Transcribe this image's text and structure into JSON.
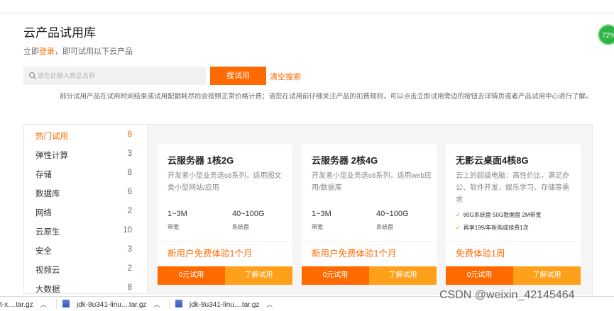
{
  "header": {
    "title": "云产品试用库",
    "subtitle_prefix": "立即",
    "subtitle_link": "登录",
    "subtitle_suffix": "，即可试用以下云产品",
    "badge": "72%"
  },
  "search": {
    "placeholder": "请在此输入商品名称",
    "button_label": "搜试用",
    "clear_label": "清空搜索"
  },
  "notice": "部分试用产品在试用时间结束或试用配额耗尽后会按照正常价格计费；请您在试用前仔细关注产品的扣费规则，可以点击立即试用旁边的按钮去详情页或者产品试用中心进行了解。",
  "sidebar": {
    "items": [
      {
        "label": "热门试用",
        "count": "8"
      },
      {
        "label": "弹性计算",
        "count": "3"
      },
      {
        "label": "存储",
        "count": "8"
      },
      {
        "label": "数据库",
        "count": "6"
      },
      {
        "label": "网络",
        "count": "2"
      },
      {
        "label": "云原生",
        "count": "10"
      },
      {
        "label": "安全",
        "count": "3"
      },
      {
        "label": "视频云",
        "count": "2"
      },
      {
        "label": "大数据",
        "count": "8"
      }
    ]
  },
  "cards": [
    {
      "title": "云服务器 1核2G",
      "desc": "开发者小型业务选s6系列，适用图文类小型网站/应用",
      "spec1_value": "1~3M",
      "spec1_label": "带宽",
      "spec2_value": "40~100G",
      "spec2_label": "系统盘",
      "promo": "新用户免费体验1个月",
      "btn_try": "0元试用",
      "btn_learn": "了解试用"
    },
    {
      "title": "云服务器 2核4G",
      "desc": "开发者小型业务选s6系列，适用web应用/数据库",
      "spec1_value": "1~3M",
      "spec1_label": "带宽",
      "spec2_value": "40~100G",
      "spec2_label": "系统盘",
      "promo": "新用户免费体验1个月",
      "btn_try": "0元试用",
      "btn_learn": "了解试用"
    },
    {
      "title": "无影云桌面4核8G",
      "desc": "云上的超级电脑：高性价比，满足办公、软件开发、娱乐学习、存储等需求",
      "feature1": "80G系统盘 50G数据盘 2M带宽",
      "feature2": "再享199/年新购或续费1次",
      "promo": "免费体验1周",
      "btn_try": "0元试用",
      "btn_learn": "了解试用"
    }
  ],
  "downloads": [
    {
      "name": "t-x....tar.gz"
    },
    {
      "name": "jdk-8u341-linu....tar.gz"
    },
    {
      "name": "jdk-8u341-linu....tar.gz"
    }
  ],
  "watermark": "CSDN @weixin_42145464",
  "colors": {
    "accent": "#ff6a00",
    "accent_light": "#ffa01a",
    "badge": "#2fb344"
  }
}
